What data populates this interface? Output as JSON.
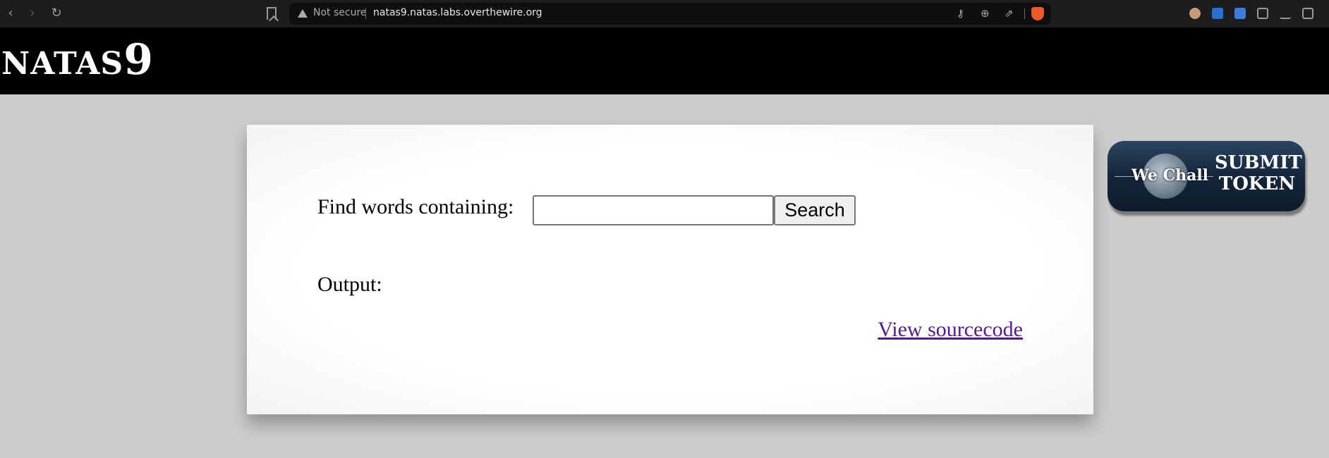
{
  "browser": {
    "not_secure": "Not secure",
    "url": "natas9.natas.labs.overthewire.org"
  },
  "header": {
    "logo_text": "NATAS",
    "logo_num": "9"
  },
  "form": {
    "find_label": "Find words containing:",
    "search_value": "",
    "search_button": "Search",
    "output_label": "Output:",
    "source_link": "View sourcecode"
  },
  "wechall": {
    "left_text": "We Chall",
    "right_line1": "SUBMIT",
    "right_line2": "TOKEN"
  }
}
